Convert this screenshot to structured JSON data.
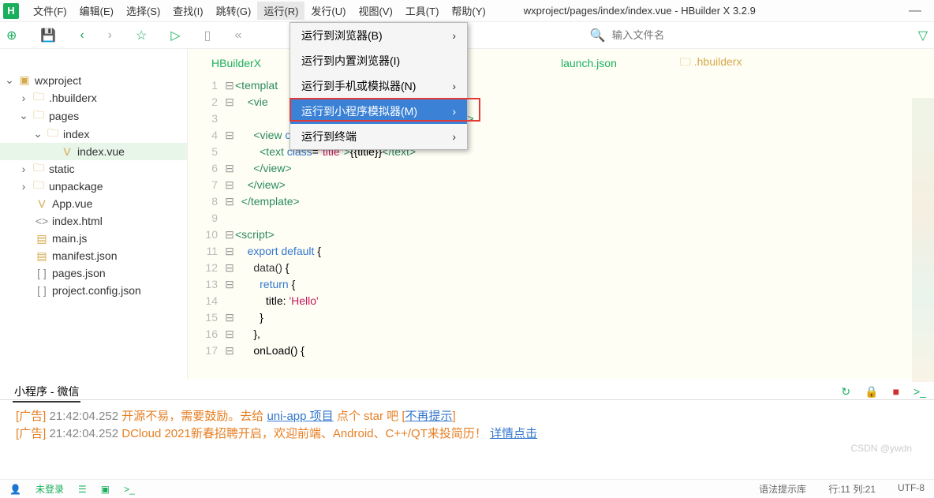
{
  "menu": {
    "file": "文件(F)",
    "edit": "编辑(E)",
    "select": "选择(S)",
    "find": "查找(I)",
    "goto": "跳转(G)",
    "run": "运行(R)",
    "release": "发行(U)",
    "view": "视图(V)",
    "tools": "工具(T)",
    "help": "帮助(Y)"
  },
  "window_title": "wxproject/pages/index/index.vue - HBuilder X 3.2.9",
  "search_placeholder": "输入文件名",
  "dropdown": {
    "browser": "运行到浏览器(B)",
    "builtin": "运行到内置浏览器(I)",
    "phone": "运行到手机或模拟器(N)",
    "mini": "运行到小程序模拟器(M)",
    "terminal": "运行到终端"
  },
  "tree": {
    "root": "wxproject",
    "hbuilderx": ".hbuilderx",
    "pages": "pages",
    "index": "index",
    "indexvue": "index.vue",
    "static": "static",
    "unpackage": "unpackage",
    "appvue": "App.vue",
    "indexhtml": "index.html",
    "mainjs": "main.js",
    "manifest": "manifest.json",
    "pagesjson": "pages.json",
    "projconf": "project.config.json"
  },
  "tabs": {
    "t1": "HBuilderX",
    "t2": "launch.json",
    "t3": ".hbuilderx"
  },
  "code": {
    "l1a": "<",
    "l1b": "template",
    "l1c": ">",
    "l2a": "<",
    "l2b": "vie",
    "l3": "                                       atic/logo.png\"></image>",
    "l4": "      <view class=\"text-area\">",
    "l5": "        <text class=\"title\">{{title}}</text>",
    "l6": "      </view>",
    "l7": "    </view>",
    "l8": "  </template>",
    "l10": "<script>",
    "l11": "    export default {",
    "l12": "      data() {",
    "l13": "        return {",
    "l14": "          title: 'Hello'",
    "l15": "        }",
    "l16": "      },",
    "l17": "      onLoad() {"
  },
  "console_tab": "小程序 - 微信",
  "console": {
    "ad": "[广告]",
    "ts": " 21:42:04.252 ",
    "line1a": "开源不易，需要鼓励。去给 ",
    "line1b": "uni-app 项目",
    "line1c": " 点个 star 吧 [",
    "line1d": "不再提示",
    "line1e": "]",
    "line2a": "DCloud 2021新春招聘开启，欢迎前端、Android、C++/QT来投简历！ ",
    "line2b": "详情点击"
  },
  "status": {
    "login": "未登录",
    "syntax": "语法提示库",
    "rowcol": "行:11  列:21",
    "enc": "UTF-8"
  },
  "watermark": "CSDN @ywdn"
}
